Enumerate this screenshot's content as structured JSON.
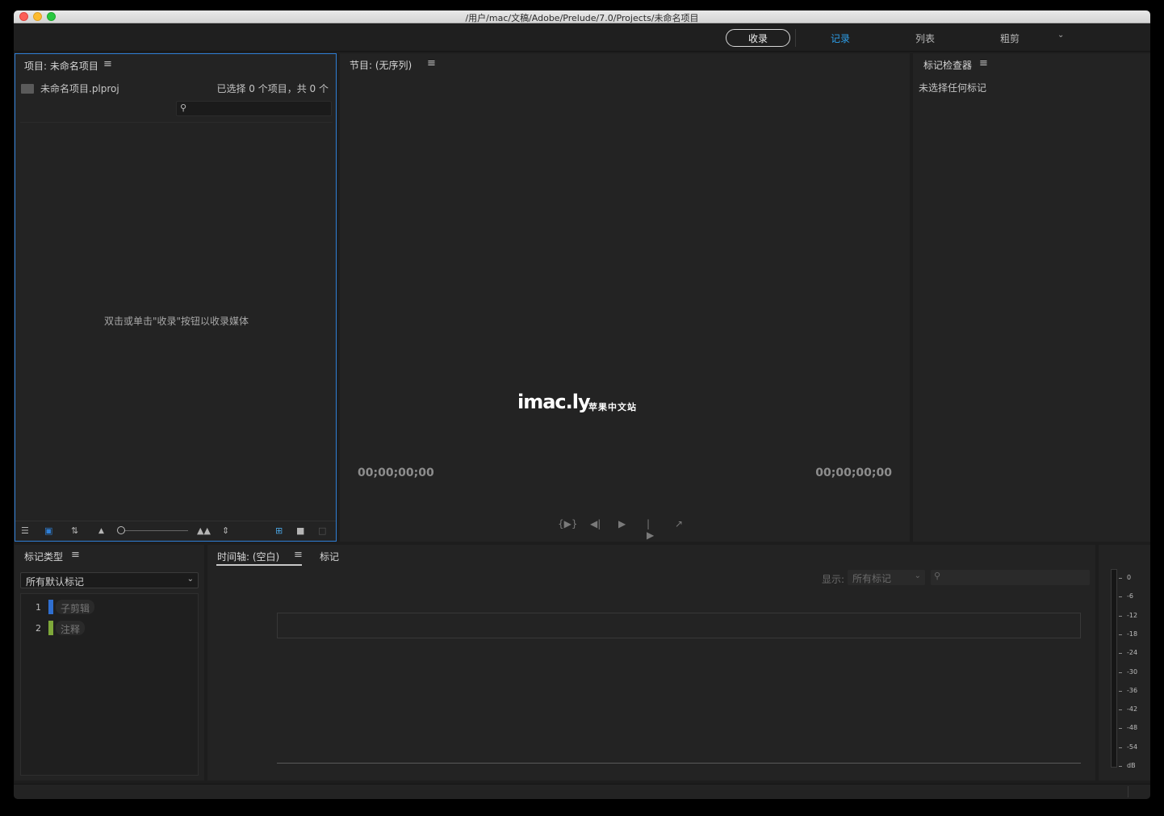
{
  "window": {
    "title": "/用户/mac/文稿/Adobe/Prelude/7.0/Projects/未命名项目"
  },
  "workspace": {
    "ingest_label": "收录",
    "tabs": [
      {
        "label": "记录",
        "active": true
      },
      {
        "label": "列表",
        "active": false
      },
      {
        "label": "粗剪",
        "active": false
      }
    ]
  },
  "project_panel": {
    "title": "项目: 未命名项目",
    "file_name": "未命名项目.plproj",
    "selection_count": "已选择 0 个项目，共 0 个",
    "empty_message": "双击或单击\"收录\"按钮以收录媒体",
    "search_placeholder": ""
  },
  "program_panel": {
    "title": "节目: (无序列)",
    "timecode_in": "00;00;00;00",
    "timecode_out": "00;00;00;00",
    "watermark_logo": "imac.ly",
    "watermark_text": "苹果中文站"
  },
  "inspector_panel": {
    "title": "标记检查器",
    "empty_message": "未选择任何标记"
  },
  "marker_type_panel": {
    "title": "标记类型",
    "filter_value": "所有默认标记",
    "items": [
      {
        "num": "1",
        "label": "子剪辑",
        "color": "#2f6fd0"
      },
      {
        "num": "2",
        "label": "注释",
        "color": "#7ea83a"
      }
    ]
  },
  "timeline_panel": {
    "title": "时间轴: (空白)",
    "markers_tab": "标记",
    "show_label": "显示:",
    "show_value": "所有标记",
    "search_placeholder": ""
  },
  "audio_meter": {
    "labels": [
      "0",
      "-6",
      "-12",
      "-18",
      "-24",
      "-30",
      "-36",
      "-42",
      "-48",
      "-54",
      "dB"
    ]
  },
  "colors": {
    "accent": "#2d9ee8",
    "panel_bg": "#232323",
    "focus_border": "#2f7fd6"
  }
}
